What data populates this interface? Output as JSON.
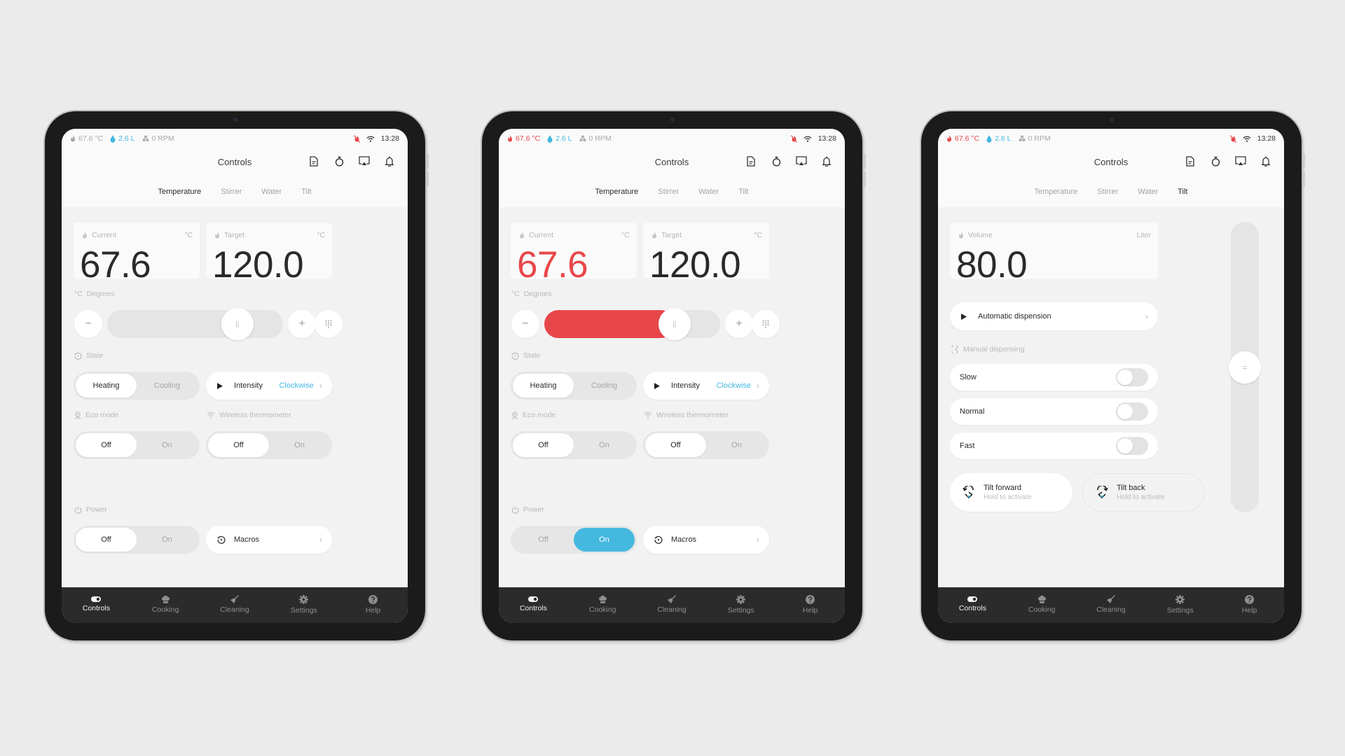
{
  "colors": {
    "accent_blue": "#45b8e0",
    "heat_red": "#e8474a",
    "nav_bg": "#2b2b2b",
    "frame": "#1b1b1b",
    "background": "#ebebeb"
  },
  "status_bar": {
    "temperature": "67.6 °C",
    "water": "2.6 L",
    "stirrer": "0 RPM",
    "time": "13:28",
    "icons": [
      "flame-icon",
      "water-drop-icon",
      "fan-icon",
      "no-heat-icon",
      "wifi-icon"
    ]
  },
  "header": {
    "title": "Controls",
    "icons": [
      "document-icon",
      "timer-icon",
      "cast-icon",
      "bell-icon"
    ]
  },
  "tabs": [
    {
      "label": "Temperature"
    },
    {
      "label": "Stirrer"
    },
    {
      "label": "Water"
    },
    {
      "label": "Tilt"
    }
  ],
  "nav": [
    {
      "label": "Controls",
      "icon": "toggle-icon"
    },
    {
      "label": "Cooking",
      "icon": "chef-hat-icon"
    },
    {
      "label": "Cleaning",
      "icon": "broom-icon"
    },
    {
      "label": "Settings",
      "icon": "gear-icon"
    },
    {
      "label": "Help",
      "icon": "help-icon"
    }
  ],
  "screens": [
    {
      "active_tab": "Temperature",
      "current": {
        "label": "Current",
        "unit": "°C",
        "value": "67.6",
        "heating_active": false
      },
      "target": {
        "label": "Target",
        "unit": "°C",
        "value": "120.0"
      },
      "degrees": {
        "label": "Degrees",
        "slider_fraction": 0.74,
        "filled": false,
        "minus": "−",
        "plus": "+"
      },
      "state": {
        "label": "State",
        "options": [
          "Heating",
          "Cooling"
        ],
        "selected": "Heating"
      },
      "intensity": {
        "label": "Intensity",
        "value": "Clockwise"
      },
      "eco_mode": {
        "label": "Eco mode",
        "options": [
          "Off",
          "On"
        ],
        "selected": "Off"
      },
      "wireless_thermometer": {
        "label": "Wireless thermometer",
        "options": [
          "Off",
          "On"
        ],
        "selected": "Off"
      },
      "power": {
        "label": "Power",
        "options": [
          "Off",
          "On"
        ],
        "selected": "Off"
      },
      "macros": {
        "label": "Macros"
      },
      "status_active": false
    },
    {
      "active_tab": "Temperature",
      "current": {
        "label": "Current",
        "unit": "°C",
        "value": "67.6",
        "heating_active": true
      },
      "target": {
        "label": "Target",
        "unit": "°C",
        "value": "120.0"
      },
      "degrees": {
        "label": "Degrees",
        "slider_fraction": 0.74,
        "filled": true,
        "minus": "−",
        "plus": "+"
      },
      "state": {
        "label": "State",
        "options": [
          "Heating",
          "Cooling"
        ],
        "selected": "Heating"
      },
      "intensity": {
        "label": "Intensity",
        "value": "Clockwise"
      },
      "eco_mode": {
        "label": "Eco mode",
        "options": [
          "Off",
          "On"
        ],
        "selected": "Off"
      },
      "wireless_thermometer": {
        "label": "Wireless thermometer",
        "options": [
          "Off",
          "On"
        ],
        "selected": "Off"
      },
      "power": {
        "label": "Power",
        "options": [
          "Off",
          "On"
        ],
        "selected": "On"
      },
      "macros": {
        "label": "Macros"
      },
      "status_active": true
    },
    {
      "active_tab": "Tilt",
      "volume": {
        "label": "Volume",
        "unit": "Liter",
        "value": "80.0"
      },
      "automatic_dispension": {
        "label": "Automatic dispension"
      },
      "manual_dispensing": {
        "label": "Manual dispensing",
        "speeds": [
          {
            "label": "Slow",
            "on": false
          },
          {
            "label": "Normal",
            "on": false
          },
          {
            "label": "Fast",
            "on": false
          }
        ]
      },
      "tilt_forward": {
        "label": "Tilt forward",
        "hint": "Hold to activate"
      },
      "tilt_back": {
        "label": "Tilt back",
        "hint": "Hold to activate"
      },
      "tilt_slider_fraction": 0.5,
      "status_active": true
    }
  ]
}
